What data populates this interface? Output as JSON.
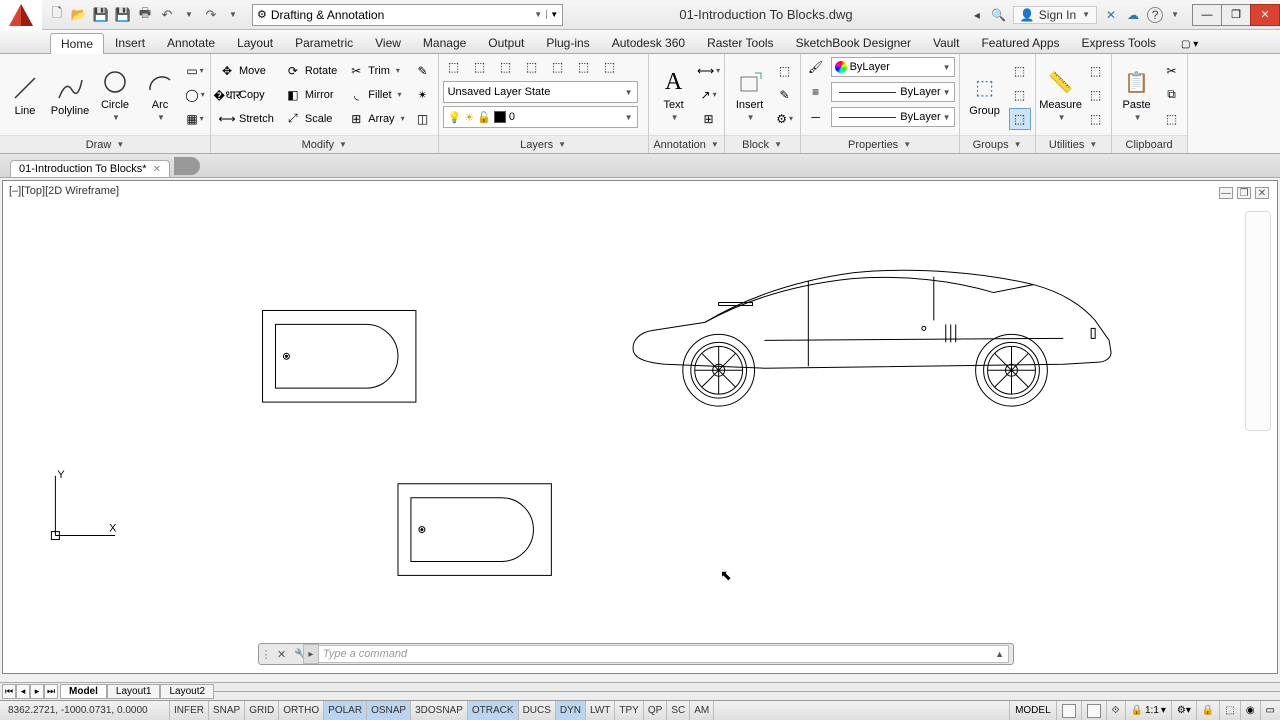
{
  "title": "01-Introduction To Blocks.dwg",
  "workspace": "Drafting & Annotation",
  "signin": "Sign In",
  "menus": [
    "Home",
    "Insert",
    "Annotate",
    "Layout",
    "Parametric",
    "View",
    "Manage",
    "Output",
    "Plug-ins",
    "Autodesk 360",
    "Raster Tools",
    "SketchBook Designer",
    "Vault",
    "Featured Apps",
    "Express Tools"
  ],
  "active_menu": 0,
  "panels": {
    "draw": {
      "title": "Draw",
      "items": [
        "Line",
        "Polyline",
        "Circle",
        "Arc"
      ]
    },
    "modify": {
      "title": "Modify",
      "items": [
        "Move",
        "Copy",
        "Stretch",
        "Rotate",
        "Mirror",
        "Scale",
        "Trim",
        "Fillet",
        "Array"
      ]
    },
    "layers": {
      "title": "Layers",
      "state": "Unsaved Layer State",
      "current": "0"
    },
    "annotation": {
      "title": "Annotation",
      "text": "Text"
    },
    "block": {
      "title": "Block",
      "insert": "Insert"
    },
    "properties": {
      "title": "Properties",
      "color": "ByLayer",
      "ltype": "ByLayer",
      "lweight": "ByLayer"
    },
    "groups": {
      "title": "Groups",
      "group": "Group"
    },
    "utilities": {
      "title": "Utilities",
      "measure": "Measure"
    },
    "clipboard": {
      "title": "Clipboard",
      "paste": "Paste"
    }
  },
  "doc_tab": "01-Introduction To Blocks*",
  "view_label": "[–][Top][2D Wireframe]",
  "cmd_placeholder": "Type a command",
  "layout_tabs": [
    "Model",
    "Layout1",
    "Layout2"
  ],
  "active_layout": 0,
  "coords": "8362.2721, -1000.0731, 0.0000",
  "toggles": [
    {
      "t": "INFER",
      "on": false
    },
    {
      "t": "SNAP",
      "on": false
    },
    {
      "t": "GRID",
      "on": false
    },
    {
      "t": "ORTHO",
      "on": false
    },
    {
      "t": "POLAR",
      "on": true
    },
    {
      "t": "OSNAP",
      "on": true
    },
    {
      "t": "3DOSNAP",
      "on": false
    },
    {
      "t": "OTRACK",
      "on": true
    },
    {
      "t": "DUCS",
      "on": false
    },
    {
      "t": "DYN",
      "on": true
    },
    {
      "t": "LWT",
      "on": false
    },
    {
      "t": "TPY",
      "on": false
    },
    {
      "t": "QP",
      "on": false
    },
    {
      "t": "SC",
      "on": false
    },
    {
      "t": "AM",
      "on": false
    }
  ],
  "status_right": {
    "model": "MODEL",
    "scale": "1:1"
  }
}
